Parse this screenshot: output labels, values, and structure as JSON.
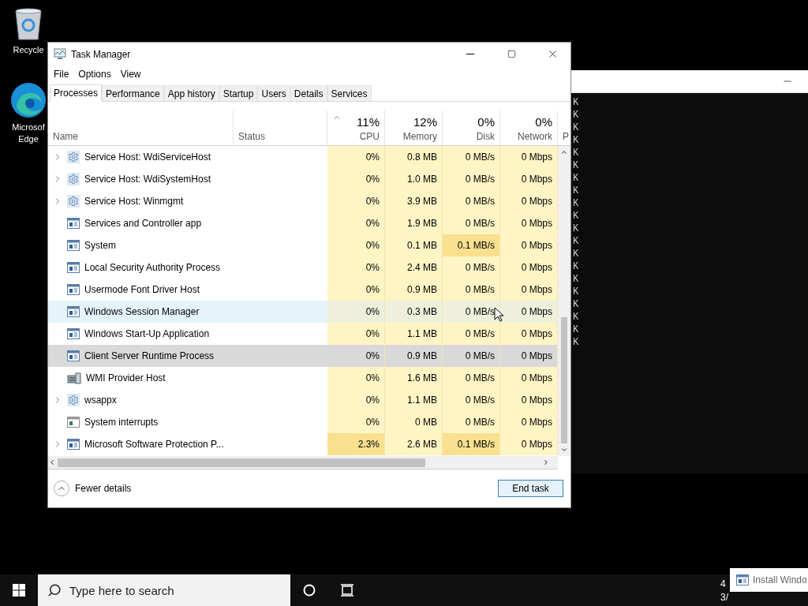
{
  "desktop_icons": [
    {
      "kind": "recycle",
      "label": "Recycle"
    },
    {
      "kind": "edge",
      "label": "Microsof Edge"
    }
  ],
  "console": {
    "lines": [
      "K",
      "K",
      "K",
      "K",
      "K",
      "K",
      "K",
      "K",
      "K",
      "K",
      "K",
      "K",
      "K",
      "K",
      "K",
      "K",
      "K",
      "K",
      "K",
      "K"
    ]
  },
  "window": {
    "title": "Task Manager",
    "menu": [
      "File",
      "Options",
      "View"
    ],
    "tabs": [
      {
        "label": "Processes",
        "selected": true
      },
      {
        "label": "Performance",
        "selected": false
      },
      {
        "label": "App history",
        "selected": false
      },
      {
        "label": "Startup",
        "selected": false
      },
      {
        "label": "Users",
        "selected": false
      },
      {
        "label": "Details",
        "selected": false
      },
      {
        "label": "Services",
        "selected": false
      }
    ],
    "columns": [
      {
        "kind": "text",
        "label": "Name"
      },
      {
        "kind": "text",
        "label": "Status"
      },
      {
        "kind": "metric",
        "percent": "11%",
        "label": "CPU",
        "sorted": true
      },
      {
        "kind": "metric",
        "percent": "12%",
        "label": "Memory",
        "sorted": false
      },
      {
        "kind": "metric",
        "percent": "0%",
        "label": "Disk",
        "sorted": false
      },
      {
        "kind": "metric",
        "percent": "0%",
        "label": "Network",
        "sorted": false
      },
      {
        "kind": "partial",
        "label": "P"
      }
    ],
    "rows": [
      {
        "name": "Service Host: WdiServiceHost",
        "kind": "gear",
        "expandable": true,
        "hovered": false,
        "selected": false,
        "values": [
          {
            "text": "0%",
            "hot": false
          },
          {
            "text": "0.8 MB",
            "hot": false
          },
          {
            "text": "0 MB/s",
            "hot": false
          },
          {
            "text": "0 Mbps",
            "hot": false
          }
        ]
      },
      {
        "name": "Service Host: WdiSystemHost",
        "kind": "gear",
        "expandable": true,
        "hovered": false,
        "selected": false,
        "values": [
          {
            "text": "0%",
            "hot": false
          },
          {
            "text": "1.0 MB",
            "hot": false
          },
          {
            "text": "0 MB/s",
            "hot": false
          },
          {
            "text": "0 Mbps",
            "hot": false
          }
        ]
      },
      {
        "name": "Service Host: Winmgmt",
        "kind": "gear",
        "expandable": true,
        "hovered": false,
        "selected": false,
        "values": [
          {
            "text": "0%",
            "hot": false
          },
          {
            "text": "3.9 MB",
            "hot": false
          },
          {
            "text": "0 MB/s",
            "hot": false
          },
          {
            "text": "0 Mbps",
            "hot": false
          }
        ]
      },
      {
        "name": "Services and Controller app",
        "kind": "app",
        "expandable": false,
        "hovered": false,
        "selected": false,
        "values": [
          {
            "text": "0%",
            "hot": false
          },
          {
            "text": "1.9 MB",
            "hot": false
          },
          {
            "text": "0 MB/s",
            "hot": false
          },
          {
            "text": "0 Mbps",
            "hot": false
          }
        ]
      },
      {
        "name": "System",
        "kind": "app",
        "expandable": false,
        "hovered": false,
        "selected": false,
        "values": [
          {
            "text": "0%",
            "hot": false
          },
          {
            "text": "0.1 MB",
            "hot": false
          },
          {
            "text": "0.1 MB/s",
            "hot": true
          },
          {
            "text": "0 Mbps",
            "hot": false
          }
        ]
      },
      {
        "name": "Local Security Authority Process",
        "kind": "app",
        "expandable": false,
        "hovered": false,
        "selected": false,
        "values": [
          {
            "text": "0%",
            "hot": false
          },
          {
            "text": "2.4 MB",
            "hot": false
          },
          {
            "text": "0 MB/s",
            "hot": false
          },
          {
            "text": "0 Mbps",
            "hot": false
          }
        ]
      },
      {
        "name": "Usermode Font Driver Host",
        "kind": "app",
        "expandable": false,
        "hovered": false,
        "selected": false,
        "values": [
          {
            "text": "0%",
            "hot": false
          },
          {
            "text": "0.9 MB",
            "hot": false
          },
          {
            "text": "0 MB/s",
            "hot": false
          },
          {
            "text": "0 Mbps",
            "hot": false
          }
        ]
      },
      {
        "name": "Windows Session Manager",
        "kind": "app",
        "expandable": false,
        "hovered": true,
        "selected": false,
        "values": [
          {
            "text": "0%",
            "hot": false
          },
          {
            "text": "0.3 MB",
            "hot": false
          },
          {
            "text": "0 MB/s",
            "hot": false
          },
          {
            "text": "0 Mbps",
            "hot": false
          }
        ]
      },
      {
        "name": "Windows Start-Up Application",
        "kind": "app",
        "expandable": false,
        "hovered": false,
        "selected": false,
        "values": [
          {
            "text": "0%",
            "hot": false
          },
          {
            "text": "1.1 MB",
            "hot": false
          },
          {
            "text": "0 MB/s",
            "hot": false
          },
          {
            "text": "0 Mbps",
            "hot": false
          }
        ]
      },
      {
        "name": "Client Server Runtime Process",
        "kind": "app",
        "expandable": false,
        "hovered": false,
        "selected": true,
        "values": [
          {
            "text": "0%",
            "hot": false
          },
          {
            "text": "0.9 MB",
            "hot": false
          },
          {
            "text": "0 MB/s",
            "hot": false
          },
          {
            "text": "0 Mbps",
            "hot": false
          }
        ]
      },
      {
        "name": "WMI Provider Host",
        "kind": "wmi",
        "expandable": false,
        "hovered": false,
        "selected": false,
        "values": [
          {
            "text": "0%",
            "hot": false
          },
          {
            "text": "1.6 MB",
            "hot": false
          },
          {
            "text": "0 MB/s",
            "hot": false
          },
          {
            "text": "0 Mbps",
            "hot": false
          }
        ]
      },
      {
        "name": "wsappx",
        "kind": "gear",
        "expandable": true,
        "hovered": false,
        "selected": false,
        "values": [
          {
            "text": "0%",
            "hot": false
          },
          {
            "text": "1.1 MB",
            "hot": false
          },
          {
            "text": "0 MB/s",
            "hot": false
          },
          {
            "text": "0 Mbps",
            "hot": false
          }
        ]
      },
      {
        "name": "System interrupts",
        "kind": "interrupts",
        "expandable": false,
        "hovered": false,
        "selected": false,
        "values": [
          {
            "text": "0%",
            "hot": false
          },
          {
            "text": "0 MB",
            "hot": false
          },
          {
            "text": "0 MB/s",
            "hot": false
          },
          {
            "text": "0 Mbps",
            "hot": false
          }
        ]
      },
      {
        "name": "Microsoft Software Protection P...",
        "kind": "app",
        "expandable": true,
        "hovered": false,
        "selected": false,
        "values": [
          {
            "text": "2.3%",
            "hot": true
          },
          {
            "text": "2.6 MB",
            "hot": false
          },
          {
            "text": "0.1 MB/s",
            "hot": true
          },
          {
            "text": "0 Mbps",
            "hot": false
          }
        ]
      }
    ],
    "footer": {
      "details_link": "Fewer details",
      "end_task": "End task"
    }
  },
  "taskbar": {
    "search_placeholder": "Type here to search",
    "clock": [
      "4",
      "3/"
    ]
  },
  "notification": {
    "text": "Install Windo"
  }
}
